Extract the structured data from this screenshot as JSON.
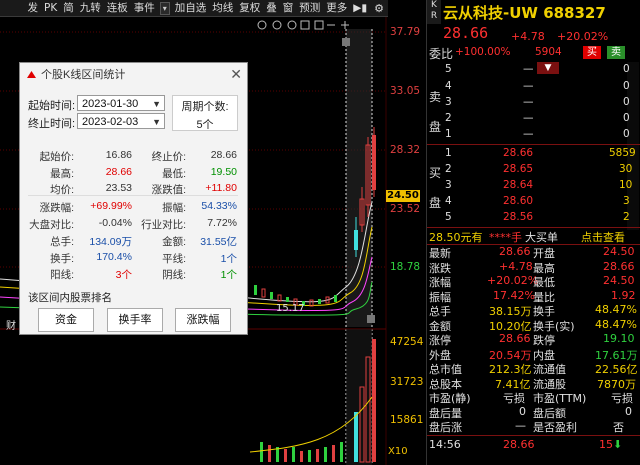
{
  "toolbar": {
    "items": [
      "发",
      "PK",
      "简",
      "九转",
      "连板",
      "事件",
      "加自选",
      "均线",
      "复权",
      "叠",
      "窗",
      "预测",
      "更多"
    ],
    "dropdown_glyph": "▾",
    "play_glyph": "▶▮",
    "gear_glyph": "⚙"
  },
  "axis": {
    "price_labels": [
      "37.79",
      "33.05",
      "28.32",
      "23.52",
      "18.78"
    ],
    "current_price_tag": "24.50",
    "volume_labels": [
      "47254",
      "31723",
      "15861"
    ],
    "volume_unit": "X10",
    "ma_value": "15.17",
    "bottom_left_char": "财"
  },
  "dialog": {
    "title": "个股K线区间统计",
    "close": "✕",
    "start_label": "起始时间:",
    "start_value": "2023-01-30",
    "end_label": "终止时间:",
    "end_value": "2023-02-03",
    "period_label": "周期个数:",
    "period_value": "5个",
    "stats": [
      {
        "l1": "起始价:",
        "v1": "16.86",
        "c1": "dk",
        "l2": "终止价:",
        "v2": "28.66",
        "c2": "dk"
      },
      {
        "l1": "最高:",
        "v1": "28.66",
        "c1": "red",
        "l2": "最低:",
        "v2": "19.50",
        "c2": "grn"
      },
      {
        "l1": "均价:",
        "v1": "23.53",
        "c1": "dk",
        "l2": "涨跌值:",
        "v2": "+11.80",
        "c2": "red"
      },
      {
        "l1": "涨跌幅:",
        "v1": "+69.99%",
        "c1": "red",
        "l2": "振幅:",
        "v2": "54.33%",
        "c2": "blu"
      },
      {
        "l1": "大盘对比:",
        "v1": "-0.04%",
        "c1": "dk",
        "l2": "行业对比:",
        "v2": "7.72%",
        "c2": "dk"
      },
      {
        "l1": "总手:",
        "v1": "134.09万",
        "c1": "blu",
        "l2": "金额:",
        "v2": "31.55亿",
        "c2": "blu"
      },
      {
        "l1": "换手:",
        "v1": "170.4%",
        "c1": "blu",
        "l2": "平线:",
        "v2": "1个",
        "c2": "blu"
      },
      {
        "l1": "阳线:",
        "v1": "3个",
        "c1": "red",
        "l2": "阴线:",
        "v2": "1个",
        "c2": "grn"
      }
    ],
    "rank_label": "该区间内股票排名",
    "buttons": [
      "资金",
      "换手率",
      "涨跌幅"
    ]
  },
  "quote": {
    "kr": "K\nR",
    "name": "云从科技-UW",
    "code": "688327",
    "price": "28.66",
    "change": "+4.78",
    "change_pct": "+20.02%",
    "weibi_label": "委比",
    "weibi_value": "+100.00%",
    "weicha_value": "5904",
    "buy_label": "买",
    "sell_label": "卖",
    "sell_side_label": "卖\n盘",
    "buy_side_label": "买\n盘",
    "asks": [
      {
        "lvl": "5",
        "price": "—",
        "vol": "0"
      },
      {
        "lvl": "4",
        "price": "—",
        "vol": "0"
      },
      {
        "lvl": "3",
        "price": "—",
        "vol": "0"
      },
      {
        "lvl": "2",
        "price": "—",
        "vol": "0"
      },
      {
        "lvl": "1",
        "price": "—",
        "vol": "0"
      }
    ],
    "bids": [
      {
        "lvl": "1",
        "price": "28.66",
        "vol": "5859"
      },
      {
        "lvl": "2",
        "price": "28.65",
        "vol": "30"
      },
      {
        "lvl": "3",
        "price": "28.64",
        "vol": "10"
      },
      {
        "lvl": "4",
        "price": "28.60",
        "vol": "3"
      },
      {
        "lvl": "5",
        "price": "28.56",
        "vol": "2"
      }
    ],
    "big_order": {
      "price": "28.50元有",
      "stars": "****手",
      "label": "大买单",
      "link": "点击查看"
    },
    "fields": [
      {
        "k1": "最新",
        "v1": "28.66",
        "c1": "c-r",
        "k2": "开盘",
        "v2": "24.50",
        "c2": "c-r"
      },
      {
        "k1": "涨跌",
        "v1": "+4.78",
        "c1": "c-r",
        "k2": "最高",
        "v2": "28.66",
        "c2": "c-r"
      },
      {
        "k1": "涨幅",
        "v1": "+20.02%",
        "c1": "c-r",
        "k2": "最低",
        "v2": "24.50",
        "c2": "c-r"
      },
      {
        "k1": "振幅",
        "v1": "17.42%",
        "c1": "c-r",
        "k2": "量比",
        "v2": "1.92",
        "c2": "c-r"
      },
      {
        "k1": "总手",
        "v1": "38.15万",
        "c1": "c-y",
        "k2": "换手",
        "v2": "48.47%",
        "c2": "c-y"
      },
      {
        "k1": "金额",
        "v1": "10.20亿",
        "c1": "c-y",
        "k2": "换手(实)",
        "v2": "48.47%",
        "c2": "c-y"
      },
      {
        "k1": "涨停",
        "v1": "28.66",
        "c1": "c-r",
        "k2": "跌停",
        "v2": "19.10",
        "c2": "c-g"
      },
      {
        "k1": "外盘",
        "v1": "20.54万",
        "c1": "c-r",
        "k2": "内盘",
        "v2": "17.61万",
        "c2": "c-g"
      },
      {
        "k1": "总市值",
        "v1": "212.3亿",
        "c1": "c-y",
        "k2": "流通值",
        "v2": "22.56亿",
        "c2": "c-y"
      },
      {
        "k1": "总股本",
        "v1": "7.41亿",
        "c1": "c-y",
        "k2": "流通股",
        "v2": "7870万",
        "c2": "c-y"
      },
      {
        "k1": "市盈(静)",
        "v1": "亏损",
        "c1": "c-w",
        "k2": "市盈(TTM)",
        "v2": "亏损",
        "c2": "c-w"
      },
      {
        "k1": "盘后量",
        "v1": "0",
        "c1": "c-w",
        "k2": "盘后额",
        "v2": "0",
        "c2": "c-w"
      },
      {
        "k1": "盘后涨",
        "v1": "—",
        "c1": "c-w",
        "k2": "是否盈利",
        "v2": "否",
        "c2": "c-w"
      }
    ],
    "last_trade": {
      "time": "14:56",
      "price": "28.66",
      "vol": "15",
      "arrow": "⬇"
    }
  }
}
